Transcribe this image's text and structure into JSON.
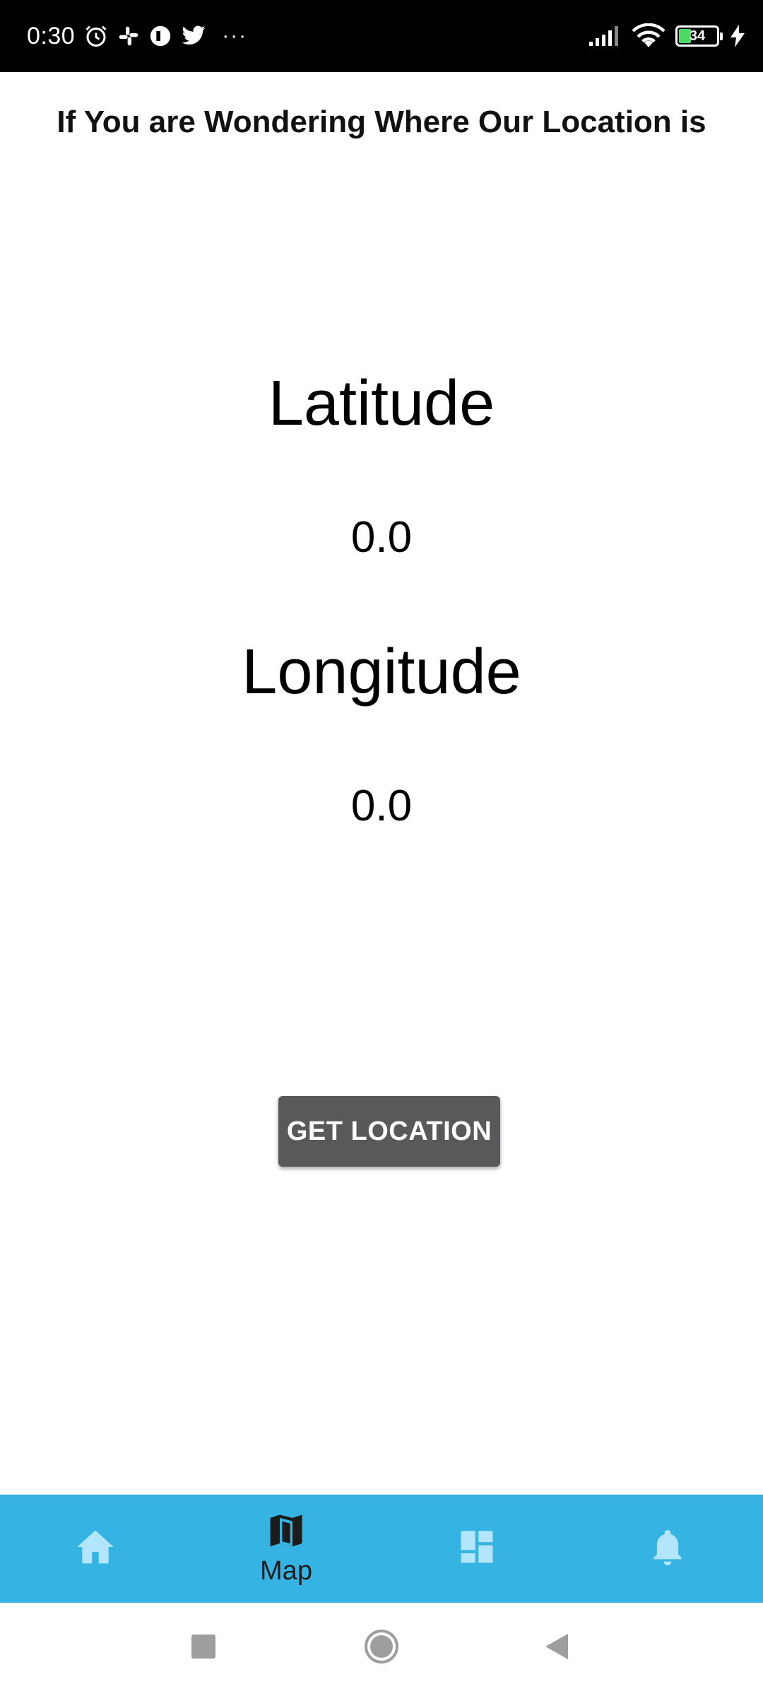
{
  "status_bar": {
    "time": "0:30",
    "battery_level": "34",
    "icons": [
      "alarm-icon",
      "slack-icon",
      "app-icon",
      "twitter-icon",
      "more-icon",
      "signal-icon",
      "wifi-icon",
      "battery-icon",
      "charging-icon"
    ],
    "more": "···"
  },
  "main": {
    "title": "If You are Wondering Where Our Location is",
    "latitude_label": "Latitude",
    "latitude_value": "0.0",
    "longitude_label": "Longitude",
    "longitude_value": "0.0",
    "get_location_label": "GET LOCATION"
  },
  "bottom_nav": {
    "items": [
      {
        "icon": "home-icon",
        "label": "",
        "active": false
      },
      {
        "icon": "map-icon",
        "label": "Map",
        "active": true
      },
      {
        "icon": "dashboard-icon",
        "label": "",
        "active": false
      },
      {
        "icon": "bell-icon",
        "label": "",
        "active": false
      }
    ],
    "active_color": "#1c1c1c",
    "inactive_color": "#b3e5fc",
    "background": "#35b3e3"
  },
  "system_nav": {
    "icons": [
      "recents-square-icon",
      "home-circle-icon",
      "back-triangle-icon"
    ]
  }
}
